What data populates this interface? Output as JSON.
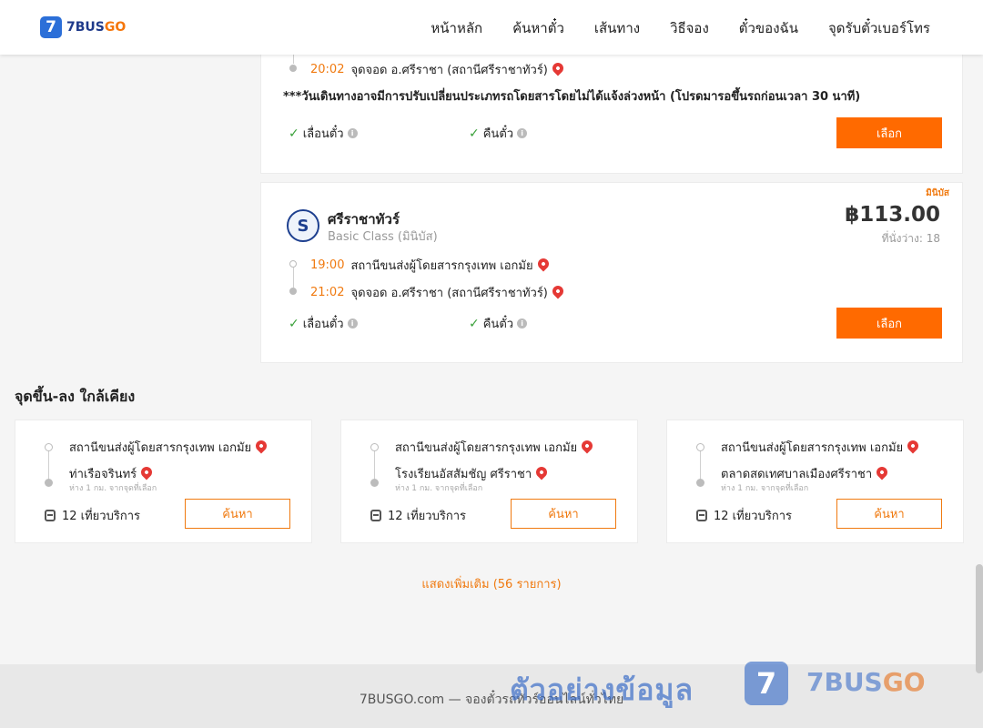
{
  "header": {
    "logo_mark": "7",
    "logo_brand": "7BUS",
    "logo_go": "GO",
    "nav": [
      "หน้าหลัก",
      "ค้นหาตั๋ว",
      "เส้นทาง",
      "วิธีจอง",
      "ตั๋วของฉัน",
      "จุดรับตั๋วเบอร์โทร"
    ]
  },
  "trip1": {
    "arrive_time": "20:02",
    "arrive_stop": "จุดจอด อ.ศรีราชา (สถานีศรีราชาทัวร์)",
    "notice": "***วันเดินทางอาจมีการปรับเปลี่ยนประเภทรถโดยสารโดยไม่ได้แจ้งล่วงหน้า (โปรดมารอขึ้นรถก่อนเวลา 30 นาที)",
    "feature1": "เลื่อนตั๋ว",
    "feature2": "คืนตั๋ว",
    "select_label": "เลือก"
  },
  "trip2": {
    "type_badge": "มินิบัส",
    "company": "ศรีราชาทัวร์",
    "class": "Basic Class (มินิบัส)",
    "price": "฿113.00",
    "seats": "ที่นั่งว่าง: 18",
    "depart_time": "19:00",
    "depart_stop": "สถานีขนส่งผู้โดยสารกรุงเทพ เอกมัย",
    "arrive_time": "21:02",
    "arrive_stop": "จุดจอด อ.ศรีราชา (สถานีศรีราชาทัวร์)",
    "feature1": "เลื่อนตั๋ว",
    "feature2": "คืนตั๋ว",
    "select_label": "เลือก"
  },
  "nearby": {
    "title": "จุดขึ้น-ลง ใกล้เคียง",
    "cards": [
      {
        "from": "สถานีขนส่งผู้โดยสารกรุงเทพ เอกมัย",
        "to": "ท่าเรือจรินทร์",
        "distance": "ห่าง 1 กม. จากจุดที่เลือก",
        "trips": "12 เที่ยวบริการ",
        "button": "ค้นหา"
      },
      {
        "from": "สถานีขนส่งผู้โดยสารกรุงเทพ เอกมัย",
        "to": "โรงเรียนอัสสัมชัญ ศรีราชา",
        "distance": "ห่าง 1 กม. จากจุดที่เลือก",
        "trips": "12 เที่ยวบริการ",
        "button": "ค้นหา"
      },
      {
        "from": "สถานีขนส่งผู้โดยสารกรุงเทพ เอกมัย",
        "to": "ตลาดสดเทศบาลเมืองศรีราชา",
        "distance": "ห่าง 1 กม. จากจุดที่เลือก",
        "trips": "12 เที่ยวบริการ",
        "button": "ค้นหา"
      }
    ],
    "more_link": "แสดงเพิ่มเติม (56 รายการ)"
  },
  "footer": {
    "text": "7BUSGO.com — จองตั๋วรถทัวร์ออนไลน์ทั่วไทย"
  },
  "watermark": {
    "text": "ตัวอย่างข้อมูล",
    "mark": "7",
    "brand": "7BUS",
    "go": "GO"
  },
  "colors": {
    "accent": "#ff6a00",
    "time": "#f07a10",
    "check": "#3aa13a",
    "pin": "#e53935",
    "brand_blue": "#2c6fd8"
  }
}
